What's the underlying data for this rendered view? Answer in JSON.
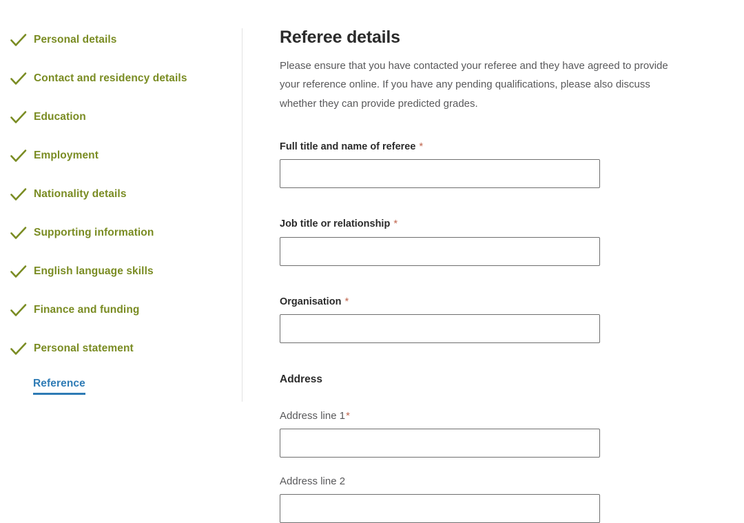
{
  "sidebar": {
    "items": [
      {
        "label": "Personal details",
        "state": "complete",
        "icon": "check-icon"
      },
      {
        "label": "Contact and residency details",
        "state": "complete",
        "icon": "check-icon"
      },
      {
        "label": "Education",
        "state": "complete",
        "icon": "check-icon"
      },
      {
        "label": "Employment",
        "state": "complete",
        "icon": "check-icon"
      },
      {
        "label": "Nationality details",
        "state": "complete",
        "icon": "check-icon"
      },
      {
        "label": "Supporting information",
        "state": "complete",
        "icon": "check-icon"
      },
      {
        "label": "English language skills",
        "state": "complete",
        "icon": "check-icon"
      },
      {
        "label": "Finance and funding",
        "state": "complete",
        "icon": "check-icon"
      },
      {
        "label": "Personal statement",
        "state": "complete",
        "icon": "check-icon"
      }
    ],
    "active_item": {
      "label": "Reference",
      "state": "current"
    },
    "colors": {
      "complete": "#7a8c23",
      "active": "#2e7bb5",
      "divider": "#e2e2e2"
    }
  },
  "main": {
    "title": "Referee details",
    "intro": "Please ensure that you have contacted your referee and they have agreed to provide your reference online. If you have any pending qualifications, please also discuss whether they can provide predicted grades.",
    "required_marker": "*",
    "required_color": "#c0674f",
    "fields": [
      {
        "label": "Full title and name of referee",
        "required": true,
        "value": "",
        "placeholder": "",
        "style": "bold"
      },
      {
        "label": "Job title or relationship",
        "required": true,
        "value": "",
        "placeholder": "",
        "style": "bold"
      },
      {
        "label": "Organisation",
        "required": true,
        "value": "",
        "placeholder": "",
        "style": "bold"
      }
    ],
    "address_section": {
      "heading": "Address",
      "fields": [
        {
          "label": "Address line 1",
          "required": true,
          "value": "",
          "placeholder": "",
          "style": "light"
        },
        {
          "label": "Address line 2",
          "required": false,
          "value": "",
          "placeholder": "",
          "style": "light"
        }
      ]
    }
  }
}
